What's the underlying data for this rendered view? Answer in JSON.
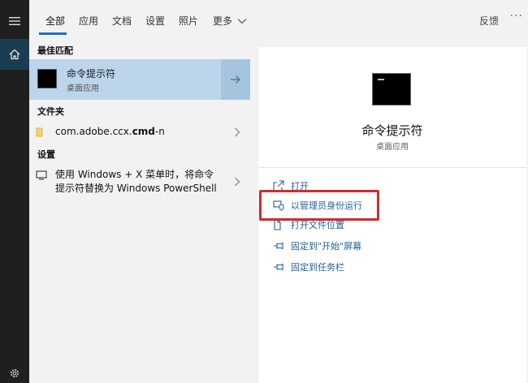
{
  "tabs": [
    {
      "label": "全部"
    },
    {
      "label": "应用"
    },
    {
      "label": "文档"
    },
    {
      "label": "设置"
    },
    {
      "label": "照片"
    },
    {
      "label": "更多"
    }
  ],
  "header": {
    "feedback_label": "反馈",
    "more_options": "···"
  },
  "sections": {
    "best_match": "最佳匹配",
    "folders": "文件夹",
    "settings": "设置"
  },
  "best_match": {
    "title": "命令提示符",
    "subtitle": "桌面应用"
  },
  "folder_item": {
    "name_prefix": "com.adobe.ccx.",
    "name_bold": "cmd",
    "name_suffix": "-n"
  },
  "settings_item": {
    "line1": "使用 Windows + X 菜单时，将命令",
    "line2": "提示符替换为 Windows PowerShell"
  },
  "preview": {
    "title": "命令提示符",
    "subtitle": "桌面应用"
  },
  "actions": [
    {
      "label": "打开",
      "icon": "open-icon"
    },
    {
      "label": "以管理员身份运行",
      "icon": "run-as-admin-icon"
    },
    {
      "label": "打开文件位置",
      "icon": "folder-location-icon"
    },
    {
      "label": "固定到\"开始\"屏幕",
      "icon": "pin-icon"
    },
    {
      "label": "固定到任务栏",
      "icon": "pin-icon"
    }
  ],
  "colors": {
    "accent": "#1f6fbf",
    "selected_row": "#bcd5eb",
    "highlight": "#d12b2b",
    "rail": "#1f1f1f"
  }
}
